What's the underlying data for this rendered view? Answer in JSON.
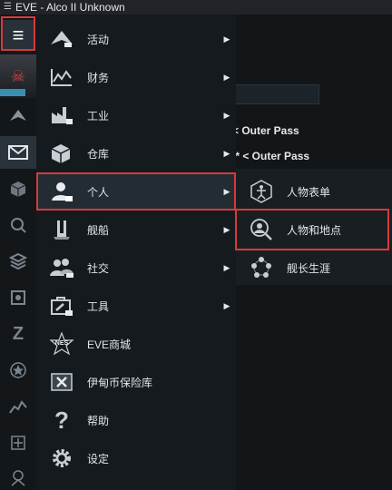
{
  "window": {
    "title": "EVE - Alco II Unknown",
    "title_icon": "menu-icon"
  },
  "background_window": {
    "rows": [
      "< Outer Pass",
      "l* < Outer Pass"
    ]
  },
  "neocom": {
    "items": [
      {
        "name": "menu-icon"
      },
      {
        "name": "character-portrait"
      },
      {
        "name": "activities-icon"
      },
      {
        "name": "mail-icon"
      },
      {
        "name": "inventory-icon"
      },
      {
        "name": "search-icon"
      },
      {
        "name": "skills-icon"
      },
      {
        "name": "fitting-icon"
      },
      {
        "name": "z-icon"
      },
      {
        "name": "star-icon"
      },
      {
        "name": "chart-icon"
      },
      {
        "name": "agency-icon"
      },
      {
        "name": "locator-icon"
      }
    ]
  },
  "main_menu": {
    "items": [
      {
        "label": "活动",
        "icon": "activities-icon",
        "has_submenu": true
      },
      {
        "label": "财务",
        "icon": "finance-icon",
        "has_submenu": true
      },
      {
        "label": "工业",
        "icon": "industry-icon",
        "has_submenu": true
      },
      {
        "label": "仓库",
        "icon": "inventory-icon",
        "has_submenu": true
      },
      {
        "label": "个人",
        "icon": "personal-icon",
        "has_submenu": true,
        "selected": true
      },
      {
        "label": "舰船",
        "icon": "ship-icon",
        "has_submenu": true
      },
      {
        "label": "社交",
        "icon": "social-icon",
        "has_submenu": true
      },
      {
        "label": "工具",
        "icon": "tools-icon",
        "has_submenu": true
      },
      {
        "label": "EVE商城",
        "icon": "nes-store-icon",
        "has_submenu": false
      },
      {
        "label": "伊甸币保险库",
        "icon": "plex-vault-icon",
        "has_submenu": false
      },
      {
        "label": "帮助",
        "icon": "help-icon",
        "has_submenu": false
      },
      {
        "label": "设定",
        "icon": "settings-icon",
        "has_submenu": false
      }
    ]
  },
  "submenu": {
    "items": [
      {
        "label": "人物表单",
        "icon": "character-sheet-icon"
      },
      {
        "label": "人物和地点",
        "icon": "people-places-icon",
        "highlighted": true
      },
      {
        "label": "舰长生涯",
        "icon": "career-icon"
      }
    ]
  },
  "colors": {
    "highlight": "#d83a3a",
    "menu_bg": "#151a1e",
    "selected_bg": "#242c33"
  }
}
